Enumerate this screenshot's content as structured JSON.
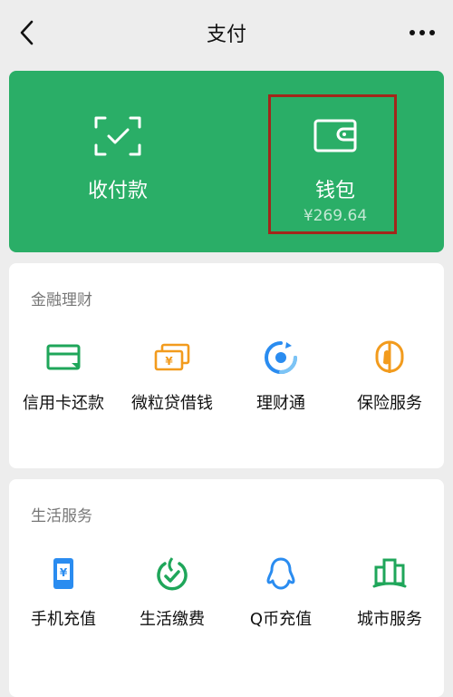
{
  "header": {
    "title": "支付"
  },
  "wallet_card": {
    "receive_pay": {
      "label": "收付款"
    },
    "wallet": {
      "label": "钱包",
      "balance": "¥269.64"
    }
  },
  "finance": {
    "title": "金融理财",
    "items": [
      {
        "label": "信用卡还款",
        "icon": "credit-card-icon"
      },
      {
        "label": "微粒贷借钱",
        "icon": "cash-stack-icon"
      },
      {
        "label": "理财通",
        "icon": "wealth-icon"
      },
      {
        "label": "保险服务",
        "icon": "insurance-icon"
      }
    ]
  },
  "life": {
    "title": "生活服务",
    "items": [
      {
        "label": "手机充值",
        "icon": "phone-recharge-icon"
      },
      {
        "label": "生活缴费",
        "icon": "utility-payment-icon"
      },
      {
        "label": "Q币充值",
        "icon": "penguin-icon"
      },
      {
        "label": "城市服务",
        "icon": "city-buildings-icon"
      }
    ]
  },
  "colors": {
    "brand_green": "#2aae67",
    "highlight": "#a3261a",
    "finance_green": "#1fa65a",
    "finance_orange": "#f29b1d",
    "life_blue": "#2a8cf0"
  }
}
